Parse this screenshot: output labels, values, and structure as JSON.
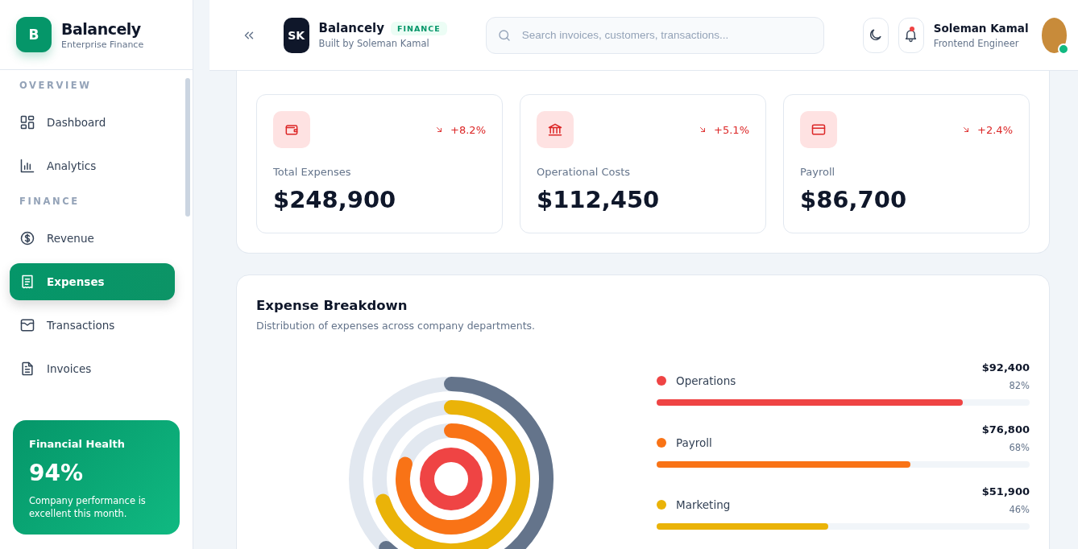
{
  "sidebar": {
    "brand": {
      "logo": "B",
      "name": "Balancely",
      "tagline": "Enterprise Finance"
    },
    "sections": [
      {
        "label": "OVERVIEW",
        "items": [
          {
            "label": "Dashboard",
            "selected": false
          },
          {
            "label": "Analytics",
            "selected": false
          }
        ]
      },
      {
        "label": "FINANCE",
        "items": [
          {
            "label": "Revenue",
            "selected": false
          },
          {
            "label": "Expenses",
            "selected": true
          },
          {
            "label": "Transactions",
            "selected": false
          },
          {
            "label": "Invoices",
            "selected": false
          }
        ]
      }
    ],
    "health_card": {
      "title": "Financial Health",
      "value": "94%",
      "note": "Company performance is excellent this month."
    }
  },
  "header": {
    "avatar": "SK",
    "brand": "Balancely",
    "badge": "FINANCE",
    "byline": "Built by Soleman Kamal",
    "search": {
      "placeholder": "Search invoices, customers, transactions..."
    },
    "notification_dot": true,
    "user": {
      "name": "Soleman Kamal",
      "role": "Frontend Engineer",
      "online": true
    }
  },
  "stats": [
    {
      "label": "Total Expenses",
      "value": "$248,900",
      "change": "+8.2%"
    },
    {
      "label": "Operational Costs",
      "value": "$112,450",
      "change": "+5.1%"
    },
    {
      "label": "Payroll",
      "value": "$86,700",
      "change": "+2.4%"
    }
  ],
  "breakdown": {
    "title": "Expense Breakdown",
    "subtitle": "Distribution of expenses across company departments.",
    "items": [
      {
        "name": "Operations",
        "color": "#ef4444",
        "amount": "$92,400",
        "percent": "82%",
        "level": 0.82
      },
      {
        "name": "Payroll",
        "color": "#f97316",
        "amount": "$76,800",
        "percent": "68%",
        "level": 0.68
      },
      {
        "name": "Marketing",
        "color": "#eab308",
        "amount": "$51,900",
        "percent": "46%",
        "level": 0.46
      }
    ]
  }
}
